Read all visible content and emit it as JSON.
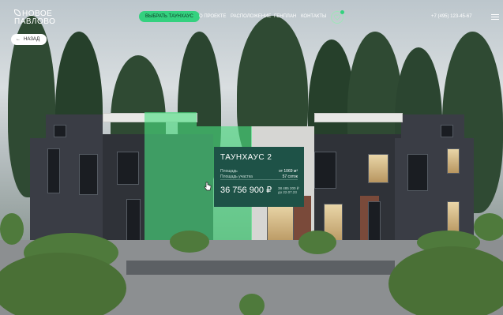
{
  "header": {
    "logo_line1": "НОВОЕ",
    "logo_line2": "ПАВЛОВО",
    "cta_label": "ВЫБРАТЬ ТАУНХАУС",
    "nav": [
      "О ПРОЕКТЕ",
      "РАСПОЛОЖЕНИЕ",
      "ГЕНПЛАН",
      "КОНТАКТЫ"
    ],
    "favorites_icon": "heart-icon",
    "phone": "+7 (495) 123-45-67",
    "menu_icon": "hamburger-icon"
  },
  "back_button": {
    "arrow": "←",
    "label": "НАЗАД"
  },
  "card": {
    "title": "ТАУНХАУС 2",
    "area_label": "Площадь",
    "area_value": "от 1069 м²",
    "plot_label": "Площадь участка",
    "plot_value": "57 соток",
    "price": "36 756 900 ₽",
    "old_price_line1": "38 485 200 ₽",
    "old_price_line2": "до 22.07.23"
  },
  "colors": {
    "accent": "#34d17f",
    "card_bg": "#1e5247",
    "highlight": "#4ade80"
  }
}
